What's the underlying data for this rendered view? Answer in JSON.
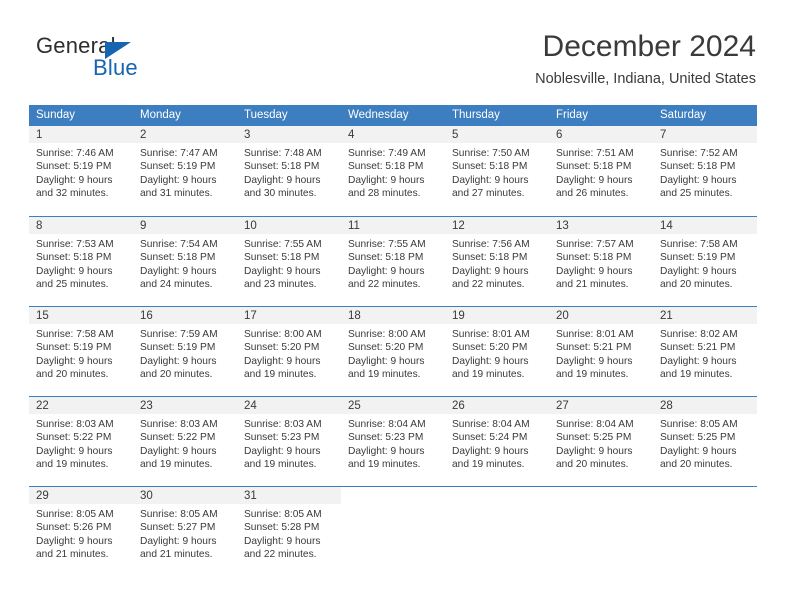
{
  "brand": {
    "name_top": "General",
    "name_bottom": "Blue",
    "triangle_color": "#1565b0",
    "text_color": "#2e2e2e"
  },
  "header": {
    "title": "December 2024",
    "subtitle": "Noblesville, Indiana, United States"
  },
  "theme": {
    "header_band": "#3c7ebf",
    "header_text": "#ffffff",
    "daynum_band": "#f2f2f2",
    "body_text": "#3a3a3a",
    "page_background": "#ffffff",
    "row_separator": "#3c7ebf"
  },
  "calendar": {
    "weekday_headers": [
      "Sunday",
      "Monday",
      "Tuesday",
      "Wednesday",
      "Thursday",
      "Friday",
      "Saturday"
    ],
    "labels": {
      "sunrise_prefix": "Sunrise:",
      "sunset_prefix": "Sunset:",
      "daylight_prefix": "Daylight:"
    },
    "weeks": [
      [
        {
          "day": "1",
          "sunrise": "Sunrise: 7:46 AM",
          "sunset": "Sunset: 5:19 PM",
          "daylight_line1": "Daylight: 9 hours",
          "daylight_line2": "and 32 minutes."
        },
        {
          "day": "2",
          "sunrise": "Sunrise: 7:47 AM",
          "sunset": "Sunset: 5:19 PM",
          "daylight_line1": "Daylight: 9 hours",
          "daylight_line2": "and 31 minutes."
        },
        {
          "day": "3",
          "sunrise": "Sunrise: 7:48 AM",
          "sunset": "Sunset: 5:18 PM",
          "daylight_line1": "Daylight: 9 hours",
          "daylight_line2": "and 30 minutes."
        },
        {
          "day": "4",
          "sunrise": "Sunrise: 7:49 AM",
          "sunset": "Sunset: 5:18 PM",
          "daylight_line1": "Daylight: 9 hours",
          "daylight_line2": "and 28 minutes."
        },
        {
          "day": "5",
          "sunrise": "Sunrise: 7:50 AM",
          "sunset": "Sunset: 5:18 PM",
          "daylight_line1": "Daylight: 9 hours",
          "daylight_line2": "and 27 minutes."
        },
        {
          "day": "6",
          "sunrise": "Sunrise: 7:51 AM",
          "sunset": "Sunset: 5:18 PM",
          "daylight_line1": "Daylight: 9 hours",
          "daylight_line2": "and 26 minutes."
        },
        {
          "day": "7",
          "sunrise": "Sunrise: 7:52 AM",
          "sunset": "Sunset: 5:18 PM",
          "daylight_line1": "Daylight: 9 hours",
          "daylight_line2": "and 25 minutes."
        }
      ],
      [
        {
          "day": "8",
          "sunrise": "Sunrise: 7:53 AM",
          "sunset": "Sunset: 5:18 PM",
          "daylight_line1": "Daylight: 9 hours",
          "daylight_line2": "and 25 minutes."
        },
        {
          "day": "9",
          "sunrise": "Sunrise: 7:54 AM",
          "sunset": "Sunset: 5:18 PM",
          "daylight_line1": "Daylight: 9 hours",
          "daylight_line2": "and 24 minutes."
        },
        {
          "day": "10",
          "sunrise": "Sunrise: 7:55 AM",
          "sunset": "Sunset: 5:18 PM",
          "daylight_line1": "Daylight: 9 hours",
          "daylight_line2": "and 23 minutes."
        },
        {
          "day": "11",
          "sunrise": "Sunrise: 7:55 AM",
          "sunset": "Sunset: 5:18 PM",
          "daylight_line1": "Daylight: 9 hours",
          "daylight_line2": "and 22 minutes."
        },
        {
          "day": "12",
          "sunrise": "Sunrise: 7:56 AM",
          "sunset": "Sunset: 5:18 PM",
          "daylight_line1": "Daylight: 9 hours",
          "daylight_line2": "and 22 minutes."
        },
        {
          "day": "13",
          "sunrise": "Sunrise: 7:57 AM",
          "sunset": "Sunset: 5:18 PM",
          "daylight_line1": "Daylight: 9 hours",
          "daylight_line2": "and 21 minutes."
        },
        {
          "day": "14",
          "sunrise": "Sunrise: 7:58 AM",
          "sunset": "Sunset: 5:19 PM",
          "daylight_line1": "Daylight: 9 hours",
          "daylight_line2": "and 20 minutes."
        }
      ],
      [
        {
          "day": "15",
          "sunrise": "Sunrise: 7:58 AM",
          "sunset": "Sunset: 5:19 PM",
          "daylight_line1": "Daylight: 9 hours",
          "daylight_line2": "and 20 minutes."
        },
        {
          "day": "16",
          "sunrise": "Sunrise: 7:59 AM",
          "sunset": "Sunset: 5:19 PM",
          "daylight_line1": "Daylight: 9 hours",
          "daylight_line2": "and 20 minutes."
        },
        {
          "day": "17",
          "sunrise": "Sunrise: 8:00 AM",
          "sunset": "Sunset: 5:20 PM",
          "daylight_line1": "Daylight: 9 hours",
          "daylight_line2": "and 19 minutes."
        },
        {
          "day": "18",
          "sunrise": "Sunrise: 8:00 AM",
          "sunset": "Sunset: 5:20 PM",
          "daylight_line1": "Daylight: 9 hours",
          "daylight_line2": "and 19 minutes."
        },
        {
          "day": "19",
          "sunrise": "Sunrise: 8:01 AM",
          "sunset": "Sunset: 5:20 PM",
          "daylight_line1": "Daylight: 9 hours",
          "daylight_line2": "and 19 minutes."
        },
        {
          "day": "20",
          "sunrise": "Sunrise: 8:01 AM",
          "sunset": "Sunset: 5:21 PM",
          "daylight_line1": "Daylight: 9 hours",
          "daylight_line2": "and 19 minutes."
        },
        {
          "day": "21",
          "sunrise": "Sunrise: 8:02 AM",
          "sunset": "Sunset: 5:21 PM",
          "daylight_line1": "Daylight: 9 hours",
          "daylight_line2": "and 19 minutes."
        }
      ],
      [
        {
          "day": "22",
          "sunrise": "Sunrise: 8:03 AM",
          "sunset": "Sunset: 5:22 PM",
          "daylight_line1": "Daylight: 9 hours",
          "daylight_line2": "and 19 minutes."
        },
        {
          "day": "23",
          "sunrise": "Sunrise: 8:03 AM",
          "sunset": "Sunset: 5:22 PM",
          "daylight_line1": "Daylight: 9 hours",
          "daylight_line2": "and 19 minutes."
        },
        {
          "day": "24",
          "sunrise": "Sunrise: 8:03 AM",
          "sunset": "Sunset: 5:23 PM",
          "daylight_line1": "Daylight: 9 hours",
          "daylight_line2": "and 19 minutes."
        },
        {
          "day": "25",
          "sunrise": "Sunrise: 8:04 AM",
          "sunset": "Sunset: 5:23 PM",
          "daylight_line1": "Daylight: 9 hours",
          "daylight_line2": "and 19 minutes."
        },
        {
          "day": "26",
          "sunrise": "Sunrise: 8:04 AM",
          "sunset": "Sunset: 5:24 PM",
          "daylight_line1": "Daylight: 9 hours",
          "daylight_line2": "and 19 minutes."
        },
        {
          "day": "27",
          "sunrise": "Sunrise: 8:04 AM",
          "sunset": "Sunset: 5:25 PM",
          "daylight_line1": "Daylight: 9 hours",
          "daylight_line2": "and 20 minutes."
        },
        {
          "day": "28",
          "sunrise": "Sunrise: 8:05 AM",
          "sunset": "Sunset: 5:25 PM",
          "daylight_line1": "Daylight: 9 hours",
          "daylight_line2": "and 20 minutes."
        }
      ],
      [
        {
          "day": "29",
          "sunrise": "Sunrise: 8:05 AM",
          "sunset": "Sunset: 5:26 PM",
          "daylight_line1": "Daylight: 9 hours",
          "daylight_line2": "and 21 minutes."
        },
        {
          "day": "30",
          "sunrise": "Sunrise: 8:05 AM",
          "sunset": "Sunset: 5:27 PM",
          "daylight_line1": "Daylight: 9 hours",
          "daylight_line2": "and 21 minutes."
        },
        {
          "day": "31",
          "sunrise": "Sunrise: 8:05 AM",
          "sunset": "Sunset: 5:28 PM",
          "daylight_line1": "Daylight: 9 hours",
          "daylight_line2": "and 22 minutes."
        },
        {
          "day": "",
          "sunrise": "",
          "sunset": "",
          "daylight_line1": "",
          "daylight_line2": ""
        },
        {
          "day": "",
          "sunrise": "",
          "sunset": "",
          "daylight_line1": "",
          "daylight_line2": ""
        },
        {
          "day": "",
          "sunrise": "",
          "sunset": "",
          "daylight_line1": "",
          "daylight_line2": ""
        },
        {
          "day": "",
          "sunrise": "",
          "sunset": "",
          "daylight_line1": "",
          "daylight_line2": ""
        }
      ]
    ]
  }
}
